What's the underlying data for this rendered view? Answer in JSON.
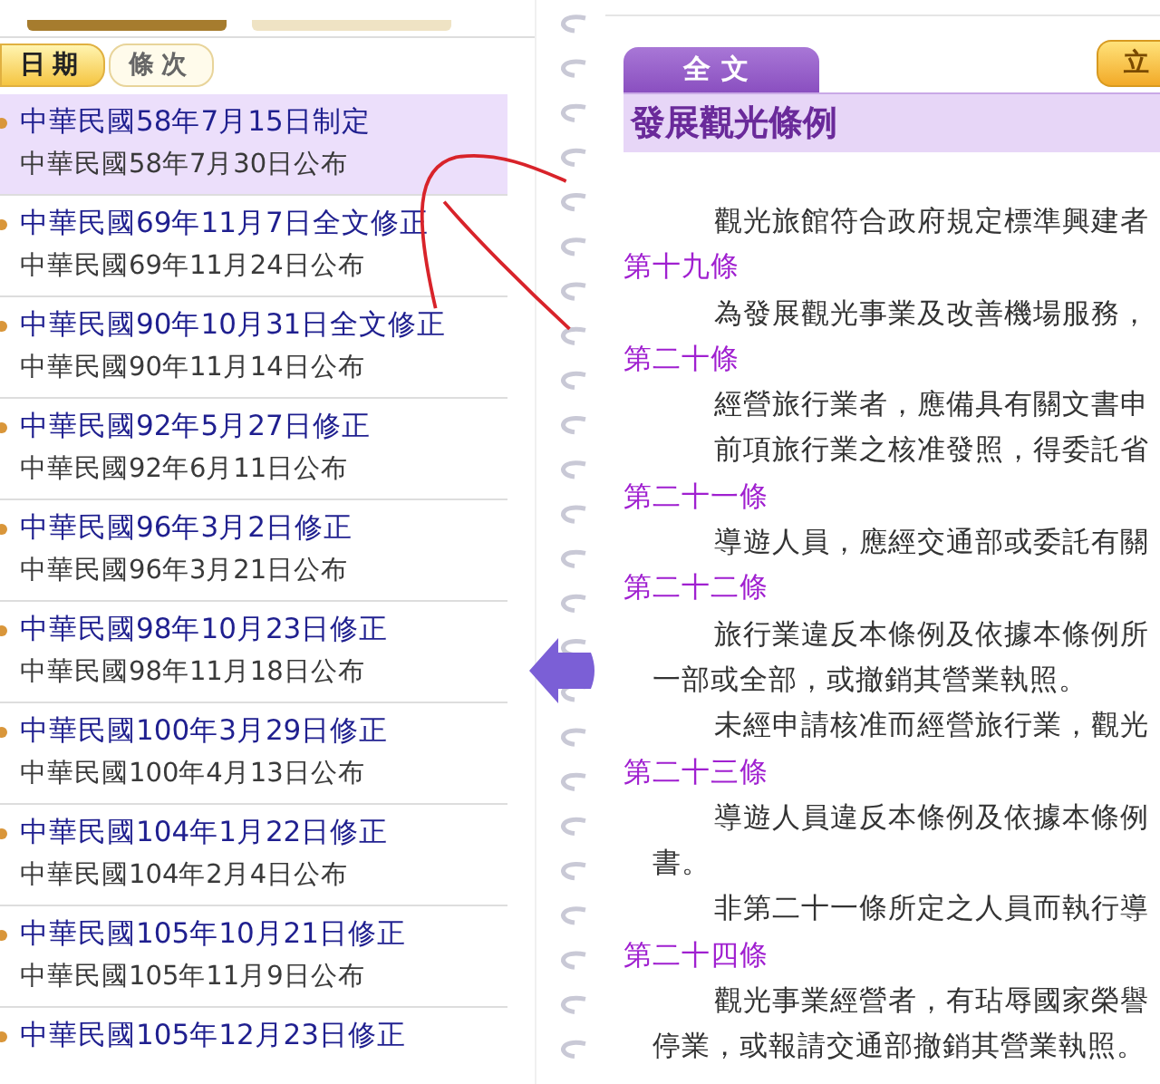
{
  "sort_buttons": [
    {
      "label": "日期",
      "selected": true
    },
    {
      "label": "條次",
      "selected": false
    }
  ],
  "history": [
    {
      "title": "中華民國58年7月15日制定",
      "subtitle": "中華民國58年7月30日公布",
      "selected": true
    },
    {
      "title": "中華民國69年11月7日全文修正",
      "subtitle": "中華民國69年11月24日公布",
      "selected": false
    },
    {
      "title": "中華民國90年10月31日全文修正",
      "subtitle": "中華民國90年11月14日公布",
      "selected": false
    },
    {
      "title": "中華民國92年5月27日修正",
      "subtitle": "中華民國92年6月11日公布",
      "selected": false
    },
    {
      "title": "中華民國96年3月2日修正",
      "subtitle": "中華民國96年3月21日公布",
      "selected": false
    },
    {
      "title": "中華民國98年10月23日修正",
      "subtitle": "中華民國98年11月18日公布",
      "selected": false
    },
    {
      "title": "中華民國100年3月29日修正",
      "subtitle": "中華民國100年4月13日公布",
      "selected": false
    },
    {
      "title": "中華民國104年1月22日修正",
      "subtitle": "中華民國104年2月4日公布",
      "selected": false
    },
    {
      "title": "中華民國105年10月21日修正",
      "subtitle": "中華民國105年11月9日公布",
      "selected": false
    },
    {
      "title": "中華民國105年12月23日修正",
      "selected": false
    }
  ],
  "content_tab": {
    "label": "全文"
  },
  "side_button": {
    "label": "立"
  },
  "law_title": "發展觀光條例",
  "blocks": [
    {
      "kind": "paragraph",
      "lines": [
        "觀光旅館符合政府規定標準興建者"
      ]
    },
    {
      "kind": "heading",
      "text": "第十九條"
    },
    {
      "kind": "paragraph",
      "lines": [
        "為發展觀光事業及改善機場服務，"
      ]
    },
    {
      "kind": "heading",
      "text": "第二十條"
    },
    {
      "kind": "paragraph",
      "lines": [
        "經營旅行業者，應備具有關文書申"
      ]
    },
    {
      "kind": "paragraph",
      "lines": [
        "前項旅行業之核准發照，得委託省"
      ]
    },
    {
      "kind": "heading",
      "text": "第二十一條"
    },
    {
      "kind": "paragraph",
      "lines": [
        "導遊人員，應經交通部或委託有關"
      ]
    },
    {
      "kind": "heading",
      "text": "第二十二條"
    },
    {
      "kind": "paragraph",
      "lines": [
        "旅行業違反本條例及依據本條例所",
        "一部或全部，或撤銷其營業執照。"
      ]
    },
    {
      "kind": "paragraph",
      "lines": [
        "未經申請核准而經營旅行業，觀光"
      ]
    },
    {
      "kind": "heading",
      "text": "第二十三條"
    },
    {
      "kind": "paragraph",
      "lines": [
        "導遊人員違反本條例及依據本條例",
        "書。"
      ]
    },
    {
      "kind": "paragraph",
      "lines": [
        "非第二十一條所定之人員而執行導"
      ]
    },
    {
      "kind": "heading",
      "text": "第二十四條"
    },
    {
      "kind": "paragraph",
      "lines": [
        "觀光事業經營者，有玷辱國家榮譽",
        "停業，或報請交通部撤銷其營業執照。"
      ]
    }
  ]
}
